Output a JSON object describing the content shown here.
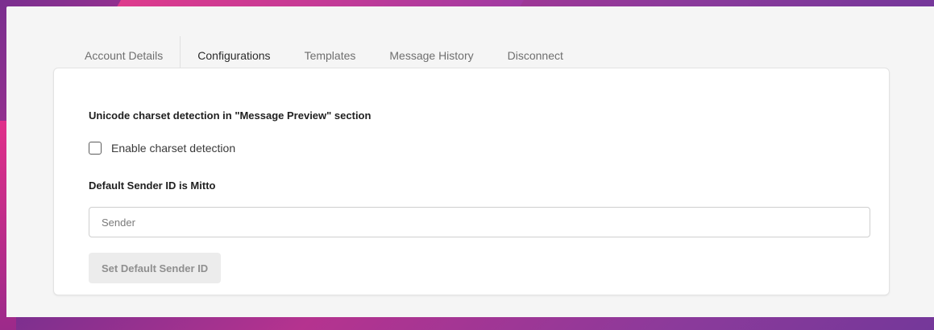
{
  "tabs": [
    {
      "label": "Account Details",
      "active": false
    },
    {
      "label": "Configurations",
      "active": true
    },
    {
      "label": "Templates",
      "active": false
    },
    {
      "label": "Message History",
      "active": false
    },
    {
      "label": "Disconnect",
      "active": false
    }
  ],
  "config": {
    "charset_section_title": "Unicode charset detection in \"Message Preview\" section",
    "charset_checkbox_label": "Enable charset detection",
    "charset_checkbox_checked": false,
    "sender_section_title": "Default Sender ID is Mitto",
    "sender_input_value": "",
    "sender_input_placeholder": "Sender",
    "set_sender_button_label": "Set Default Sender ID",
    "set_sender_button_disabled": true
  },
  "colors": {
    "accent": "#0b8a5d",
    "background_gradient_start": "#b5338f",
    "background_gradient_end": "#5a3598",
    "panel": "#f5f5f5",
    "card": "#ffffff"
  }
}
